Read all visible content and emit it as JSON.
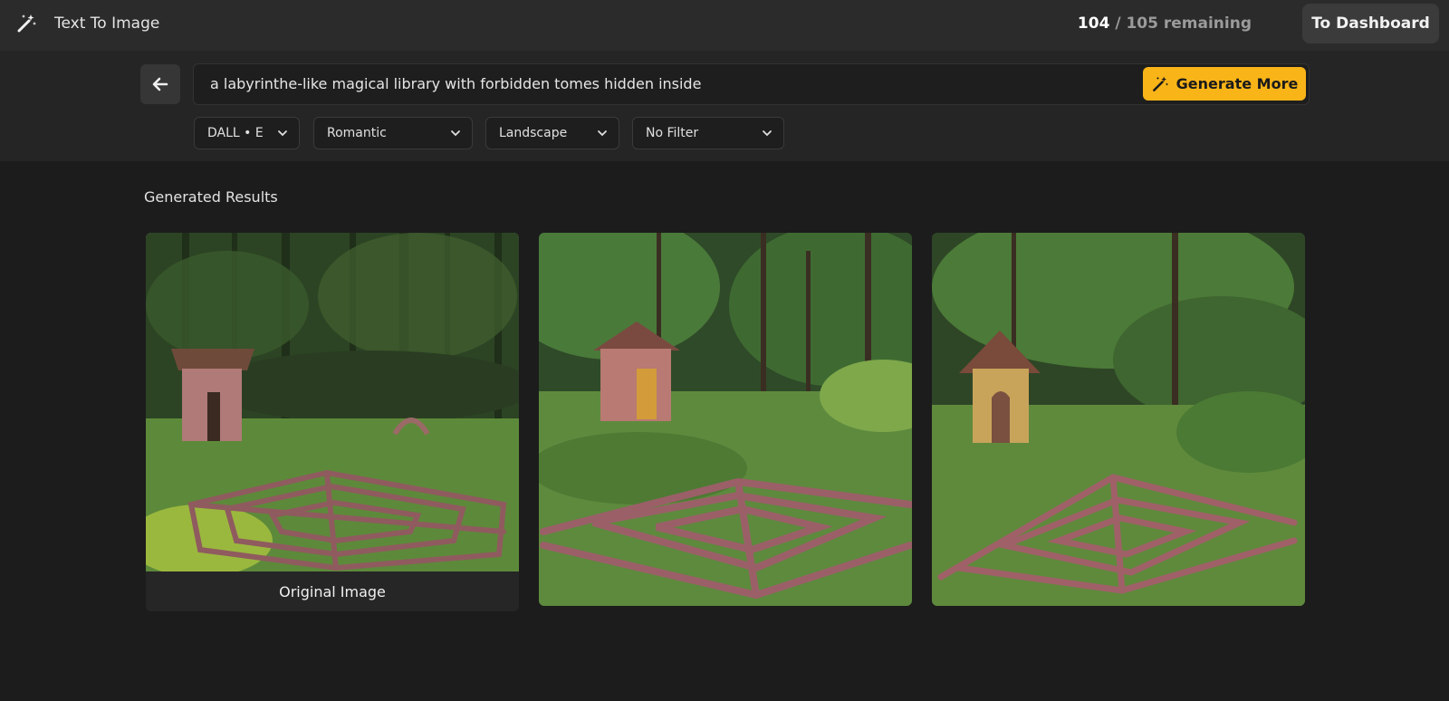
{
  "header": {
    "title": "Text To Image",
    "quota_used": "104",
    "quota_rest": "/ 105 remaining",
    "dashboard_label": "To Dashboard"
  },
  "prompt": {
    "value": "a labyrinthe-like magical library with forbidden tomes hidden inside",
    "generate_label": "Generate More"
  },
  "filters": [
    {
      "label": "DALL • E"
    },
    {
      "label": "Romantic"
    },
    {
      "label": "Landscape"
    },
    {
      "label": "No Filter"
    }
  ],
  "results": {
    "section_title": "Generated Results",
    "cards": [
      {
        "caption": "Original Image"
      },
      {
        "caption": ""
      },
      {
        "caption": ""
      }
    ]
  },
  "colors": {
    "accent": "#f9b418",
    "background": "#1c1c1c",
    "topbar": "#2b2b2b"
  }
}
